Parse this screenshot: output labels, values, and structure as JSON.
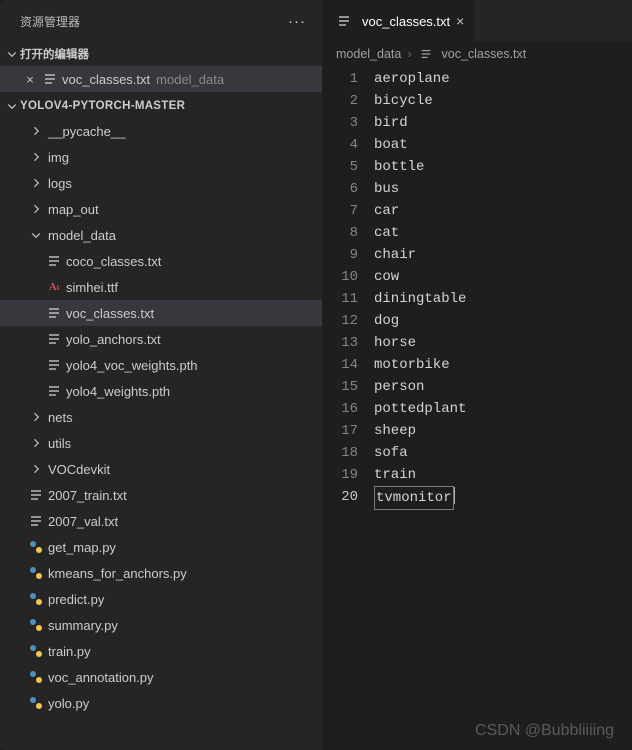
{
  "explorer": {
    "title": "资源管理器",
    "open_editors_label": "打开的编辑器",
    "open_editors": [
      {
        "name": "voc_classes.txt",
        "dir": "model_data",
        "icon": "lines"
      }
    ],
    "project_name": "YOLOV4-PYTORCH-MASTER",
    "tree": [
      {
        "type": "folder",
        "name": "__pycache__",
        "depth": 1,
        "expanded": false
      },
      {
        "type": "folder",
        "name": "img",
        "depth": 1,
        "expanded": false
      },
      {
        "type": "folder",
        "name": "logs",
        "depth": 1,
        "expanded": false
      },
      {
        "type": "folder",
        "name": "map_out",
        "depth": 1,
        "expanded": false
      },
      {
        "type": "folder",
        "name": "model_data",
        "depth": 1,
        "expanded": true
      },
      {
        "type": "file",
        "name": "coco_classes.txt",
        "depth": 2,
        "icon": "lines"
      },
      {
        "type": "file",
        "name": "simhei.ttf",
        "depth": 2,
        "icon": "font"
      },
      {
        "type": "file",
        "name": "voc_classes.txt",
        "depth": 2,
        "icon": "lines",
        "selected": true
      },
      {
        "type": "file",
        "name": "yolo_anchors.txt",
        "depth": 2,
        "icon": "lines"
      },
      {
        "type": "file",
        "name": "yolo4_voc_weights.pth",
        "depth": 2,
        "icon": "lines"
      },
      {
        "type": "file",
        "name": "yolo4_weights.pth",
        "depth": 2,
        "icon": "lines"
      },
      {
        "type": "folder",
        "name": "nets",
        "depth": 1,
        "expanded": false
      },
      {
        "type": "folder",
        "name": "utils",
        "depth": 1,
        "expanded": false
      },
      {
        "type": "folder",
        "name": "VOCdevkit",
        "depth": 1,
        "expanded": false
      },
      {
        "type": "file",
        "name": "2007_train.txt",
        "depth": 1,
        "icon": "lines"
      },
      {
        "type": "file",
        "name": "2007_val.txt",
        "depth": 1,
        "icon": "lines"
      },
      {
        "type": "file",
        "name": "get_map.py",
        "depth": 1,
        "icon": "py"
      },
      {
        "type": "file",
        "name": "kmeans_for_anchors.py",
        "depth": 1,
        "icon": "py"
      },
      {
        "type": "file",
        "name": "predict.py",
        "depth": 1,
        "icon": "py"
      },
      {
        "type": "file",
        "name": "summary.py",
        "depth": 1,
        "icon": "py"
      },
      {
        "type": "file",
        "name": "train.py",
        "depth": 1,
        "icon": "py"
      },
      {
        "type": "file",
        "name": "voc_annotation.py",
        "depth": 1,
        "icon": "py"
      },
      {
        "type": "file",
        "name": "yolo.py",
        "depth": 1,
        "icon": "py"
      }
    ]
  },
  "editor": {
    "tab": {
      "title": "voc_classes.txt"
    },
    "breadcrumb": {
      "folder": "model_data",
      "file": "voc_classes.txt"
    },
    "lines": [
      "aeroplane",
      "bicycle",
      "bird",
      "boat",
      "bottle",
      "bus",
      "car",
      "cat",
      "chair",
      "cow",
      "diningtable",
      "dog",
      "horse",
      "motorbike",
      "person",
      "pottedplant",
      "sheep",
      "sofa",
      "train",
      "tvmonitor"
    ],
    "cursor_line": 20
  },
  "watermark": "CSDN @Bubbliiiing"
}
